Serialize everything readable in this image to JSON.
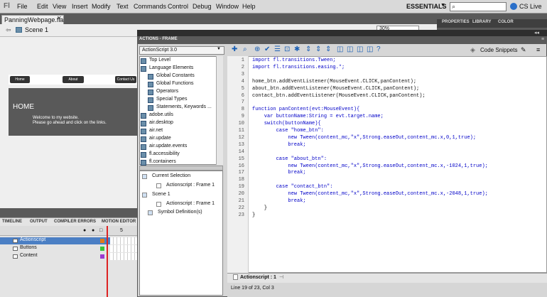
{
  "menubar": {
    "logo": "Fl",
    "items": [
      "File",
      "Edit",
      "View",
      "Insert",
      "Modify",
      "Text",
      "Commands",
      "Control",
      "Debug",
      "Window",
      "Help"
    ],
    "workspace": "ESSENTIALS",
    "cslive": "CS Live"
  },
  "document": {
    "tab": "PanningWebpage.fla",
    "scene": "Scene 1",
    "zoom": "30%",
    "stage": {
      "nav": [
        "Home",
        "About",
        "Contact Us"
      ],
      "title": "HOME",
      "line1": "Welcome to my website.",
      "line2": "Please go ahead and click on the links."
    }
  },
  "timeline": {
    "tabs": [
      "TIMELINE",
      "OUTPUT",
      "COMPILER ERRORS",
      "MOTION EDITOR"
    ],
    "frame_label": "5",
    "layers": [
      {
        "name": "Actionscript",
        "color": "#e07a1a"
      },
      {
        "name": "Buttons",
        "color": "#3ac23a"
      },
      {
        "name": "Content",
        "color": "#9a3ad0"
      }
    ]
  },
  "properties": {
    "tabs": [
      "PROPERTIES",
      "LIBRARY",
      "COLOR"
    ]
  },
  "actions": {
    "title": "ACTIONS - FRAME",
    "version": "ActionScript 3.0",
    "code_snippets": "Code Snippets",
    "library": [
      {
        "label": "Top Level",
        "type": "book",
        "indent": 0
      },
      {
        "label": "Language Elements",
        "type": "book",
        "indent": 0
      },
      {
        "label": "Global Constants",
        "type": "book",
        "indent": 1
      },
      {
        "label": "Global Functions",
        "type": "book",
        "indent": 1
      },
      {
        "label": "Operators",
        "type": "book",
        "indent": 1
      },
      {
        "label": "Special Types",
        "type": "book",
        "indent": 1
      },
      {
        "label": "Statements, Keywords ...",
        "type": "book",
        "indent": 1
      },
      {
        "label": "adobe.utils",
        "type": "book",
        "indent": 0
      },
      {
        "label": "air.desktop",
        "type": "book",
        "indent": 0
      },
      {
        "label": "air.net",
        "type": "book",
        "indent": 0
      },
      {
        "label": "air.update",
        "type": "book",
        "indent": 0
      },
      {
        "label": "air.update.events",
        "type": "book",
        "indent": 0
      },
      {
        "label": "fl.accessibility",
        "type": "book",
        "indent": 0
      },
      {
        "label": "fl.containers",
        "type": "book",
        "indent": 0
      }
    ],
    "outline": [
      {
        "label": "Current Selection",
        "indent": 0
      },
      {
        "label": "Actionscript : Frame 1",
        "indent": 1
      },
      {
        "label": "Scene 1",
        "indent": 0
      },
      {
        "label": "Actionscript : Frame 1",
        "indent": 1
      },
      {
        "label": "Symbol Definition(s)",
        "indent": 0
      }
    ],
    "code": [
      "import fl.transitions.Tween;",
      "import fl.transitions.easing.*;",
      "",
      "home_btn.addEventListener(MouseEvent.CLICK,panContent);",
      "about_btn.addEventListener(MouseEvent.CLICK,panContent);",
      "contact_btn.addEventListener(MouseEvent.CLICK,panContent);",
      "",
      "function panContent(evt:MouseEvent){",
      "    var buttonName:String = evt.target.name;",
      "    switch(buttonName){",
      "        case \"home_btn\":",
      "            new Tween(content_mc,\"x\",Strong.easeOut,content_mc.x,0,1,true);",
      "            break;",
      "",
      "        case \"about_btn\":",
      "            new Tween(content_mc,\"x\",Strong.easeOut,content_mc.x,-1024,1,true);",
      "            break;",
      "",
      "        case \"contact_btn\":",
      "            new Tween(content_mc,\"x\",Strong.easeOut,content_mc.x,-2048,1,true);",
      "            break;",
      "    }",
      "}"
    ],
    "code_tab": "Actionscript : 1",
    "status": "Line 19 of 23, Col 3"
  }
}
